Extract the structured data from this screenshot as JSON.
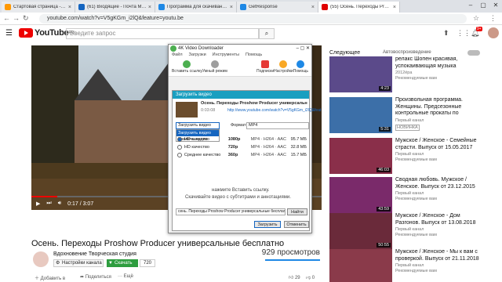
{
  "browser": {
    "tabs": [
      {
        "title": "Стартовая страница - визуальн",
        "color": "#ff9800"
      },
      {
        "title": "(61) Входящие - Почта Mail.ru",
        "color": "#1565c0"
      },
      {
        "title": "Программа для скачивания виде",
        "color": "#1e88e5"
      },
      {
        "title": "GetResponse",
        "color": "#1e88e5"
      },
      {
        "title": "(55) Осень. Переходы Proshow",
        "color": "#e00000"
      }
    ],
    "url": "youtube.com/watch?v=V5gKGm_i2lQ&feature=youtu.be"
  },
  "youtube": {
    "logo": "YouTube",
    "region": "RU",
    "search_placeholder": "Введите запрос",
    "notif_count": "9+",
    "player": {
      "time": "0:17 / 3:07",
      "progress": 0.09
    },
    "video_title": "Осень. Переходы Proshow Producer универсальные бесплатно",
    "channel": "Вдохновение Творческая студия",
    "channel_settings": "Настройки канала",
    "download": "Скачать",
    "quality": "720",
    "views": "929 просмотров",
    "add_to": "Добавить в",
    "share": "Поделиться",
    "more": "Ещё",
    "likes": "29",
    "dislikes": "0",
    "next_label": "Следующее",
    "autoplay_label": "Автовоспроизведение"
  },
  "recs": [
    {
      "title": "релакс Шопен красивая, успокаивающая музыка",
      "channel": "2012ёра",
      "sub": "Рекомендуемые вам",
      "dur": "4:23",
      "color": "#5b4a8a"
    },
    {
      "title": "Произвольная программа. Женщины. Предсезонные контрольные прокаты по",
      "channel": "Первый канал",
      "sub": "НОВИНКА",
      "dur": "5:31",
      "color": "#3c6fa8"
    },
    {
      "title": "Мужское / Женское - Семейные страсти. Выпуск от 15.05.2017",
      "channel": "Первый канал",
      "sub": "Рекомендуемые вам",
      "dur": "46:03",
      "color": "#8a2f4a"
    },
    {
      "title": "Сводная любовь. Мужское / Женское. Выпуск от 23.12.2015",
      "channel": "Первый канал",
      "sub": "Рекомендуемые вам",
      "dur": "43:59",
      "color": "#7a2a6a"
    },
    {
      "title": "Мужское / Женское - Дом Разгонов. Выпуск от 13.08.2018",
      "channel": "Первый канал",
      "sub": "Рекомендуемые вам",
      "dur": "50:55",
      "color": "#6a2a3a"
    },
    {
      "title": "Мужское / Женское - Мы к вам с проверкой. Выпуск от 21.11.2018",
      "channel": "Первый канал",
      "sub": "Рекомендуемые вам",
      "dur": "",
      "color": "#8a3a4a"
    }
  ],
  "app": {
    "title": "4K Video Downloader",
    "menu": [
      "Файл",
      "Загрузки",
      "Инструменты",
      "Помощь"
    ],
    "toolbar": {
      "paste": "Вставить ссылку",
      "smart": "Умный режим",
      "subscriptions": "Подписки",
      "settings": "Настройки",
      "help": "Помощь"
    },
    "dialog": {
      "header": "Загрузить видео",
      "video_title": "Осень. Переходы Proshow Producer универсальные беспл...",
      "duration": "0:03:08",
      "link": "http://www.youtube.com/watch?v=V5gKGm_i2lQ&feat",
      "type_select": "Загрузить видео",
      "type_options": [
        "Загрузить видео",
        "Извлечь аудио"
      ],
      "format_label": "Формат:",
      "format_value": "MP4",
      "qualities": [
        {
          "name": "HD качество",
          "res": "1080p",
          "codec": "MP4 · H264 · AAC",
          "size": "95.7 МБ"
        },
        {
          "name": "HD качество",
          "res": "720p",
          "codec": "MP4 · H264 · AAC",
          "size": "32.8 МБ"
        },
        {
          "name": "Среднее качество",
          "res": "360p",
          "codec": "MP4 · H264 · AAC",
          "size": "15.7 МБ"
        }
      ],
      "filename": "сень. Переходы Proshow Producer универсальные бесплатно.mp4",
      "browse": "Найти",
      "download": "Загрузить",
      "cancel": "Отменить"
    },
    "hint_line1": "нажмите Вставить ссылку.",
    "hint_line2": "Скачивайте видео с субтитрами и аннотациями."
  }
}
